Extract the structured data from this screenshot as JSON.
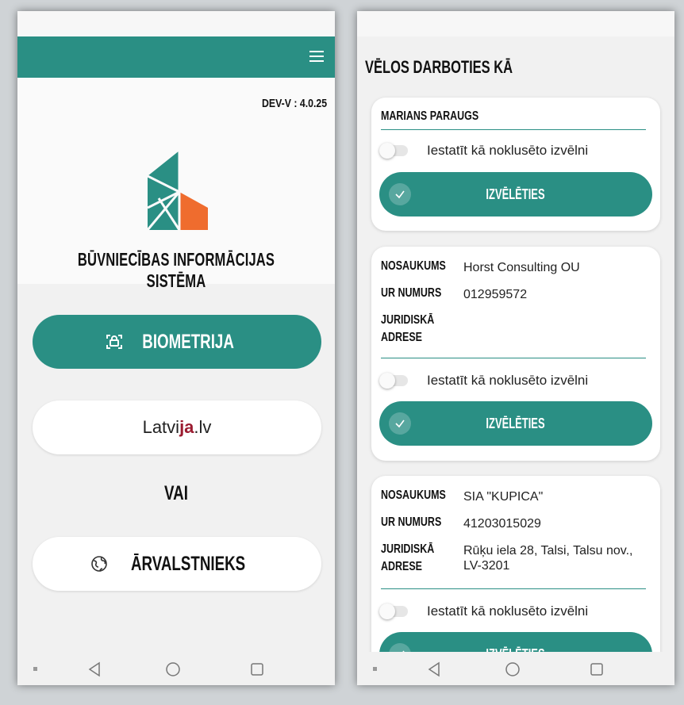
{
  "login_screen": {
    "version": "DEV-V : 4.0.25",
    "system_title": "BŪVNIECĪBAS INFORMĀCIJAS SISTĒMA",
    "biometry_label": "BIOMETRIJA",
    "latvija_label_a": "Latvi",
    "latvija_label_b": "ja",
    "latvija_label_c": ".lv",
    "or_label": "VAI",
    "foreigner_label": "ĀRVALSTNIEKS"
  },
  "role_screen": {
    "heading": "VĒLOS DARBOTIES KĀ",
    "cards": [
      {
        "name": "MARIANS PARAUGS",
        "toggle_label": "Iestatīt kā noklusēto izvēlni",
        "choose_label": "IZVĒLĒTIES"
      },
      {
        "name_label": "NOSAUKUMS",
        "name_value": "Horst Consulting OU",
        "reg_label": "UR NUMURS",
        "reg_value": "012959572",
        "address_label": "JURIDISKĀ ADRESE",
        "address_value": "",
        "toggle_label": "Iestatīt kā noklusēto izvēlni",
        "choose_label": "IZVĒLĒTIES"
      },
      {
        "name_label": "NOSAUKUMS",
        "name_value": "SIA \"KUPICA\"",
        "reg_label": "UR NUMURS",
        "reg_value": "41203015029",
        "address_label": "JURIDISKĀ ADRESE",
        "address_value": "Rūķu iela 28, Talsi, Talsu nov., LV-3201",
        "toggle_label": "Iestatīt kā noklusēto izvēlni",
        "choose_label": "IZVĒLĒTIES"
      }
    ]
  },
  "icons": {
    "menu": "hamburger-icon",
    "biometry": "face-scan-icon",
    "foreigner": "globe-icon",
    "check": "check-icon",
    "nav_back": "back-triangle-icon",
    "nav_home": "home-circle-icon",
    "nav_recent": "recent-square-icon"
  },
  "colors": {
    "primary": "#2a8f84",
    "logo_orange": "#ef6c2e",
    "latvija_red": "#9b1b30"
  }
}
